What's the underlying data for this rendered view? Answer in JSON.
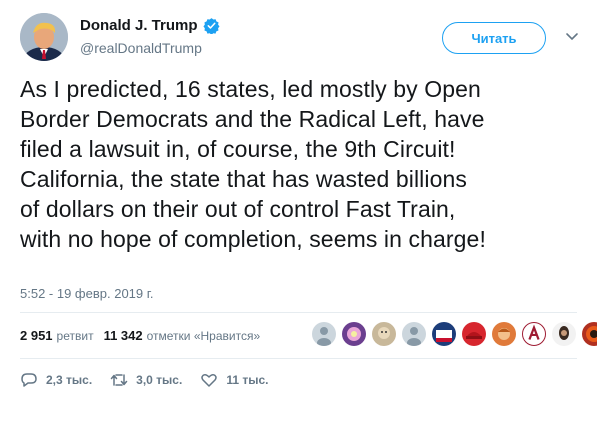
{
  "author": {
    "name": "Donald J. Trump",
    "handle": "@realDonaldTrump",
    "verified": true,
    "avatar_icon": "profile-photo"
  },
  "follow_label": "Читать",
  "tweet_lines": [
    "As I predicted, 16 states, led mostly by Open",
    "Border Democrats and the Radical Left, have",
    "filed a lawsuit in, of course, the 9th Circuit!",
    "California, the state that has wasted billions",
    "of dollars on their out of control Fast Train,",
    "with no hope of completion, seems in charge!"
  ],
  "timestamp": "5:52 - 19 февр. 2019 г.",
  "stats": {
    "retweets_count": "2 951",
    "retweets_label": "ретвит",
    "likes_count": "11 342",
    "likes_label": "отметки «Нравится»"
  },
  "likers": [
    {
      "icon": "default-avatar",
      "color": "#ccd6dd"
    },
    {
      "icon": "profile-photo",
      "color": "#6b3f8f"
    },
    {
      "icon": "profile-photo",
      "color": "#c8b89a"
    },
    {
      "icon": "default-avatar",
      "color": "#ccd6dd"
    },
    {
      "icon": "profile-photo",
      "color": "#1c3d7a"
    },
    {
      "icon": "profile-photo",
      "color": "#d7262e"
    },
    {
      "icon": "profile-photo",
      "color": "#e07a3a"
    },
    {
      "icon": "profile-photo",
      "color": "#9e1b32"
    },
    {
      "icon": "profile-photo",
      "color": "#3a2a20"
    },
    {
      "icon": "profile-photo",
      "color": "#b03020"
    }
  ],
  "actions": {
    "reply_count": "2,3 тыс.",
    "retweet_count": "3,0 тыс.",
    "like_count": "11 тыс."
  },
  "colors": {
    "accent": "#1da1f2",
    "muted": "#657786",
    "text": "#14171a"
  }
}
